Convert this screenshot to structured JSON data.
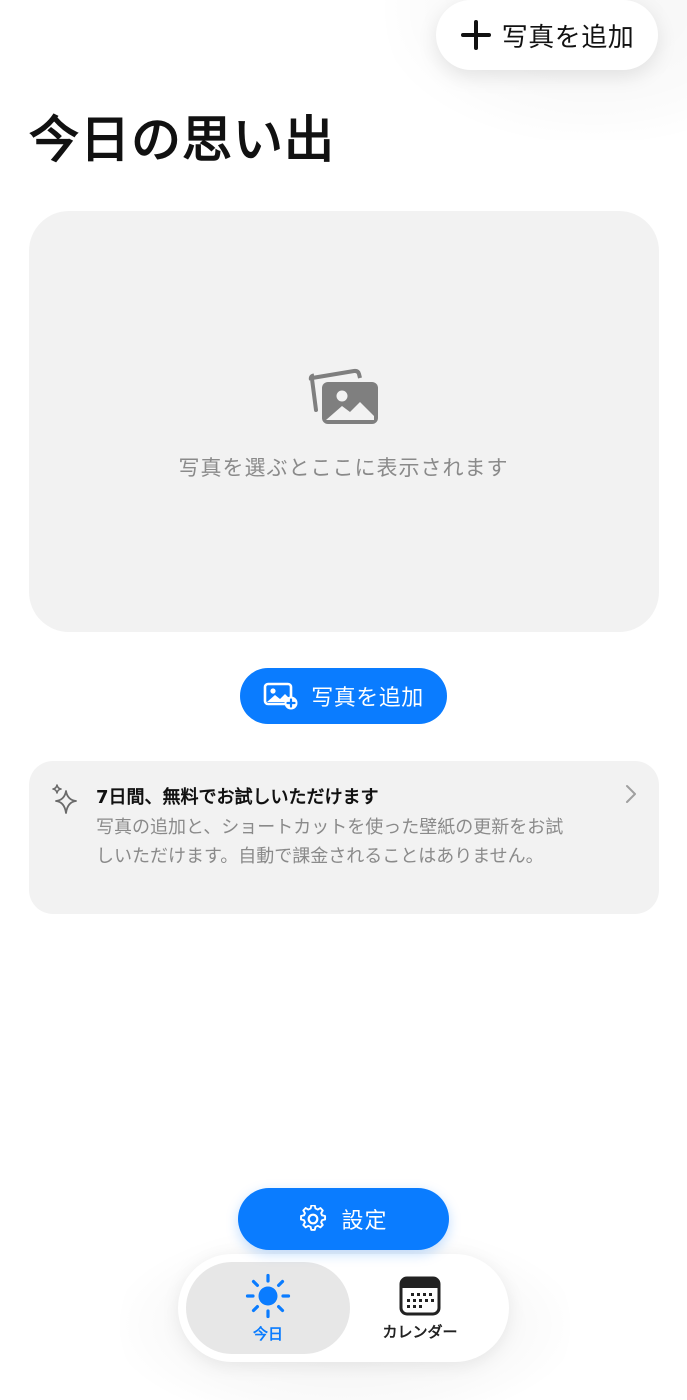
{
  "header": {
    "add_photo_label": "写真を追加"
  },
  "page_title": "今日の思い出",
  "photo_card": {
    "placeholder": "写真を選ぶとここに表示されます"
  },
  "add_photo_button": {
    "label": "写真を追加"
  },
  "trial": {
    "title": "7日間、無料でお試しいただけます",
    "body": "写真の追加と、ショートカットを使った壁紙の更新をお試しいただけます。自動で課金されることはありません。"
  },
  "settings_button": {
    "label": "設定"
  },
  "tabs": [
    {
      "label": "今日",
      "icon": "sun-icon",
      "selected": true
    },
    {
      "label": "カレンダー",
      "icon": "calendar-icon",
      "selected": false
    }
  ],
  "colors": {
    "accent": "#0a7cff",
    "card_bg": "#f2f2f2",
    "muted_text": "#8a8a8a"
  }
}
